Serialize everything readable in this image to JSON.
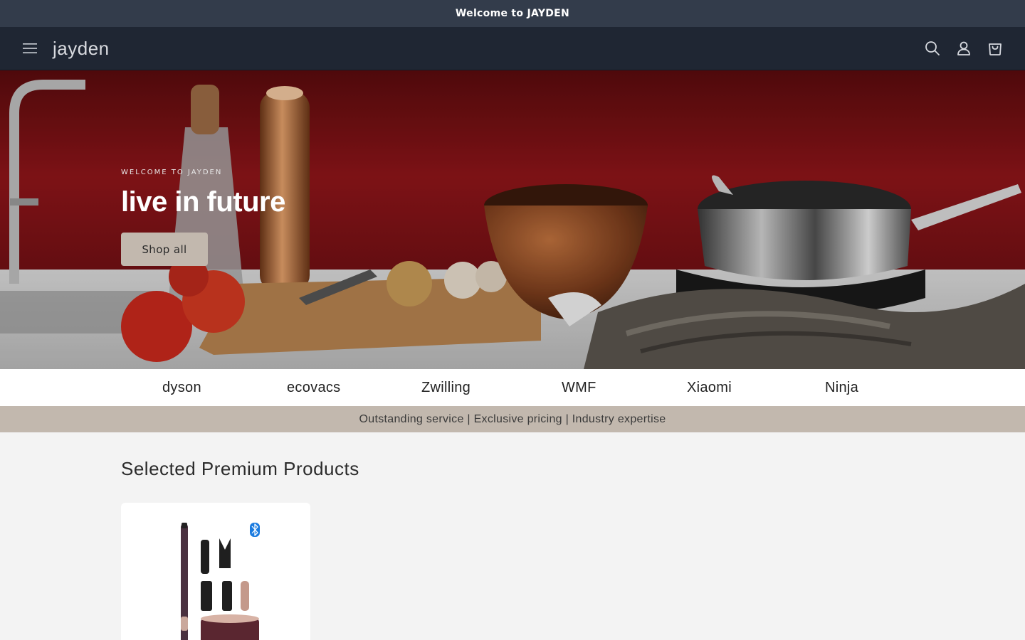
{
  "announcement": {
    "text": "Welcome to JAYDEN"
  },
  "header": {
    "logo": "jayden",
    "icons": [
      "menu-icon",
      "search-icon",
      "account-icon",
      "cart-icon"
    ]
  },
  "hero": {
    "eyebrow": "WELCOME TO JAYDEN",
    "title": "live in future",
    "button_label": "Shop all"
  },
  "brands": [
    "dyson",
    "ecovacs",
    "Zwilling",
    "WMF",
    "Xiaomi",
    "Ninja"
  ],
  "tagline": "Outstanding service | Exclusive pricing | Industry expertise",
  "products": {
    "title": "Selected Premium Products",
    "items": [
      {
        "badge_icon": "bluetooth-icon"
      }
    ]
  },
  "colors": {
    "announcement_bg": "#333c4b",
    "header_bg": "#1f2633",
    "accent": "#c2b8ae",
    "page_bg": "#f3f3f3"
  }
}
